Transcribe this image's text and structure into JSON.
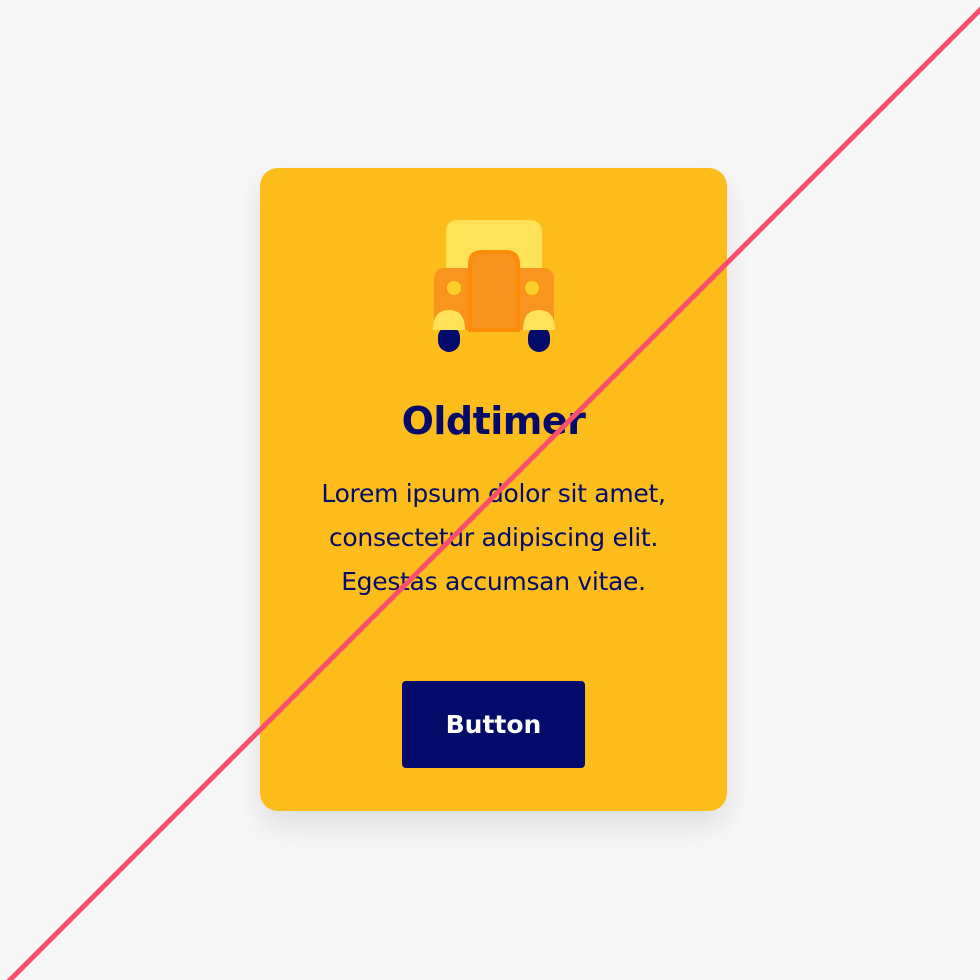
{
  "theme": {
    "page_background": "#f7f7f8",
    "card_background": "#ffbd1c",
    "text_color": "#020b6a",
    "button_background": "#020b6a",
    "button_text": "#ffffff",
    "slash_color": "#ff4d6d"
  },
  "card": {
    "icon": "oldtimer-car-icon",
    "title": "Oldtimer",
    "body_lines": [
      "Lorem ipsum dolor sit amet,",
      "consectetur adipiscing elit.",
      "Egestas accumsan vitae."
    ],
    "button_label": "Button"
  },
  "overlay": {
    "icon": "diagonal-slash"
  }
}
